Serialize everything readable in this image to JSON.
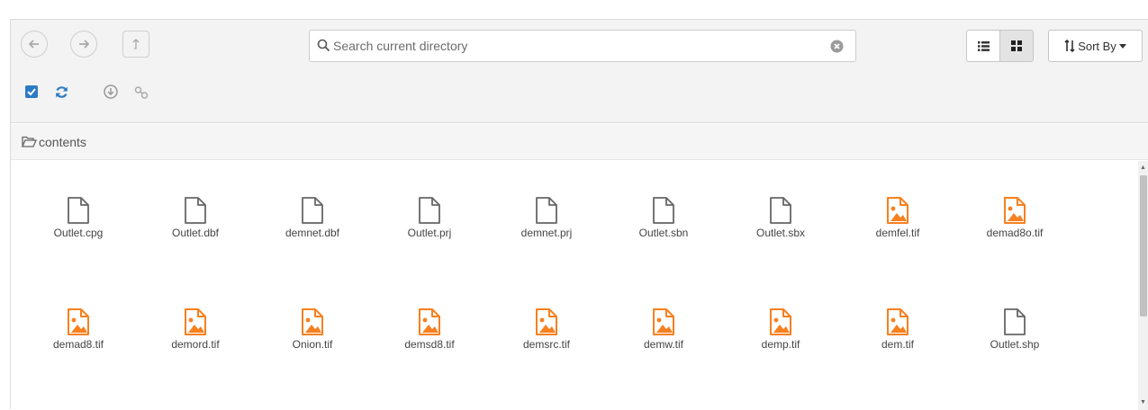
{
  "toolbar": {
    "search": {
      "placeholder": "Search current directory",
      "value": ""
    },
    "sort_label": "Sort By",
    "view_mode": "grid"
  },
  "breadcrumb": {
    "label": "contents"
  },
  "colors": {
    "image_file": "#f7801f",
    "generic_file": "#666666",
    "checkbox": "#2b7bc4"
  },
  "files": [
    {
      "name": "Outlet.cpg",
      "type": "generic"
    },
    {
      "name": "Outlet.dbf",
      "type": "generic"
    },
    {
      "name": "demnet.dbf",
      "type": "generic"
    },
    {
      "name": "Outlet.prj",
      "type": "generic"
    },
    {
      "name": "demnet.prj",
      "type": "generic"
    },
    {
      "name": "Outlet.sbn",
      "type": "generic"
    },
    {
      "name": "Outlet.sbx",
      "type": "generic"
    },
    {
      "name": "demfel.tif",
      "type": "image"
    },
    {
      "name": "demad8o.tif",
      "type": "image"
    },
    {
      "name": "demad8.tif",
      "type": "image"
    },
    {
      "name": "demord.tif",
      "type": "image"
    },
    {
      "name": "Onion.tif",
      "type": "image"
    },
    {
      "name": "demsd8.tif",
      "type": "image"
    },
    {
      "name": "demsrc.tif",
      "type": "image"
    },
    {
      "name": "demw.tif",
      "type": "image"
    },
    {
      "name": "demp.tif",
      "type": "image"
    },
    {
      "name": "dem.tif",
      "type": "image"
    },
    {
      "name": "Outlet.shp",
      "type": "generic"
    }
  ]
}
